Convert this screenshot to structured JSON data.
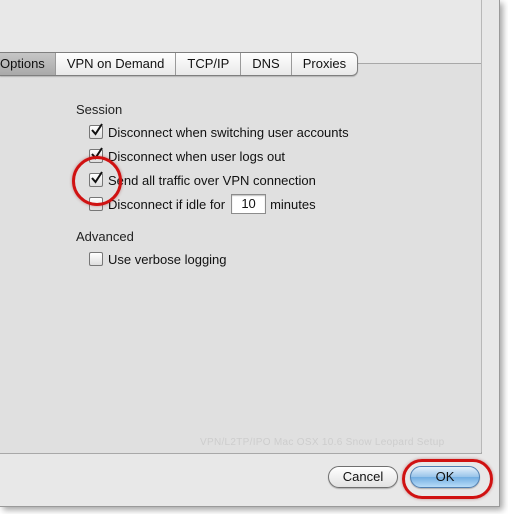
{
  "tabs": [
    {
      "label": "Options",
      "active": true
    },
    {
      "label": "VPN on Demand",
      "active": false
    },
    {
      "label": "TCP/IP",
      "active": false
    },
    {
      "label": "DNS",
      "active": false
    },
    {
      "label": "Proxies",
      "active": false
    }
  ],
  "session": {
    "title": "Session",
    "disconnect_switching": {
      "label": "Disconnect when switching user accounts",
      "checked": true
    },
    "disconnect_logout": {
      "label": "Disconnect when user logs out",
      "checked": true
    },
    "send_all_traffic": {
      "label": "Send all traffic over VPN connection",
      "checked": true
    },
    "disconnect_idle": {
      "label_before": "Disconnect if idle for",
      "value": "10",
      "label_after": "minutes",
      "checked": false
    }
  },
  "advanced": {
    "title": "Advanced",
    "verbose_logging": {
      "label": "Use verbose logging",
      "checked": false
    }
  },
  "watermark": "VPN/L2TP/IPO Mac OSX 10.6 Snow Leopard Setup",
  "buttons": {
    "cancel": "Cancel",
    "ok": "OK"
  },
  "colors": {
    "annotation_red": "#d01212",
    "default_button": "#73aee2"
  }
}
